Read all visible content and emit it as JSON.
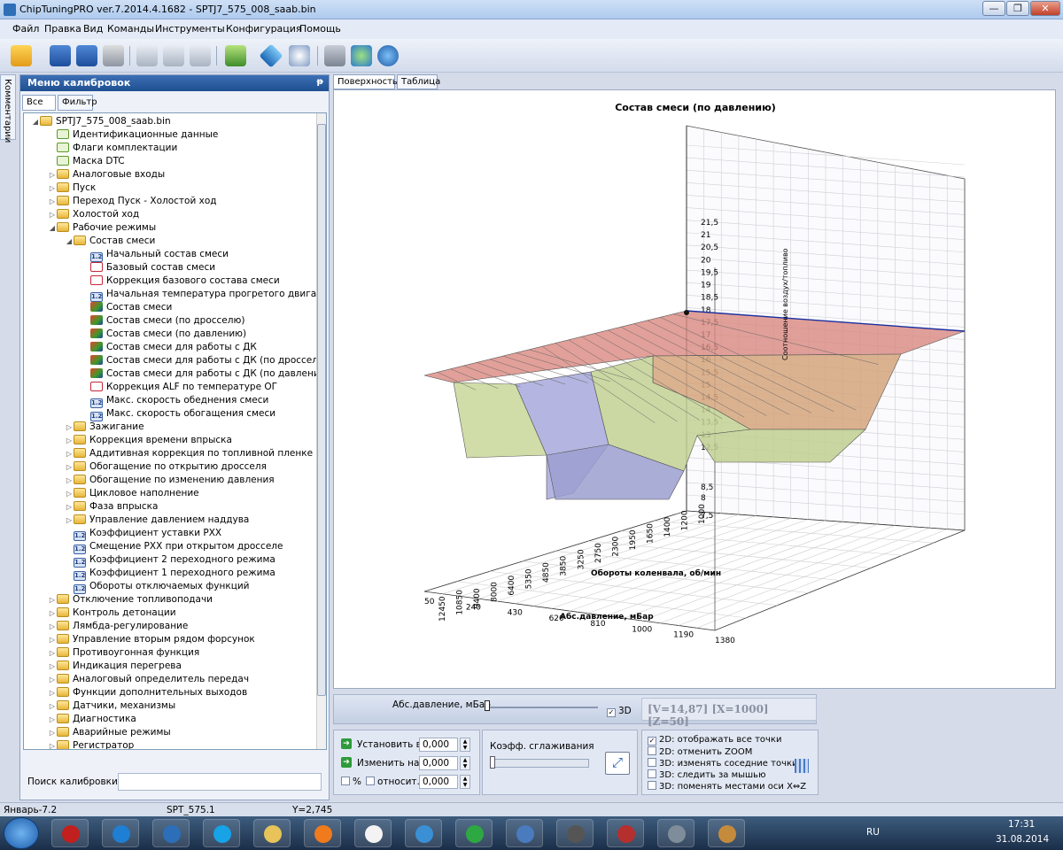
{
  "window": {
    "title": "ChipTuningPRO ver.7.2014.4.1682 - SPTJ7_575_008_saab.bin",
    "min": "—",
    "max": "❐",
    "close": "✕"
  },
  "menu": [
    "Файл",
    "Правка",
    "Вид",
    "Команды",
    "Инструменты",
    "Конфигурация",
    "Помощь"
  ],
  "toolbar_icons": [
    "open-icon",
    "save-icon",
    "save-as-icon",
    "print-icon",
    "copy-icon",
    "paste-icon",
    "undo-icon",
    "calculator-icon",
    "diamond-icon",
    "zoom-icon",
    "tools-icon",
    "network-icon",
    "help-icon"
  ],
  "side_tab": "Комментарии",
  "panel": {
    "title": "Меню калибровок",
    "pin": "ᵽ",
    "tabs": [
      "Все",
      "Фильтр"
    ],
    "search_label": "Поиск калибровки"
  },
  "tree": [
    {
      "label": "SPTJ7_575_008_saab.bin",
      "level": 0,
      "icon": "folder",
      "tw": "◢"
    },
    {
      "label": "Идентификационные данные",
      "level": 1,
      "icon": "check",
      "tw": ""
    },
    {
      "label": "Флаги комплектации",
      "level": 1,
      "icon": "check",
      "tw": ""
    },
    {
      "label": "Маска DTC",
      "level": 1,
      "icon": "check",
      "tw": ""
    },
    {
      "label": "Аналоговые входы",
      "level": 1,
      "icon": "folder",
      "tw": "▷"
    },
    {
      "label": "Пуск",
      "level": 1,
      "icon": "folder",
      "tw": "▷"
    },
    {
      "label": "Переход Пуск - Холостой ход",
      "level": 1,
      "icon": "folder",
      "tw": "▷"
    },
    {
      "label": "Холостой ход",
      "level": 1,
      "icon": "folder",
      "tw": "▷"
    },
    {
      "label": "Рабочие режимы",
      "level": 1,
      "icon": "folder",
      "tw": "◢"
    },
    {
      "label": "Состав смеси",
      "level": 2,
      "icon": "folder",
      "tw": "◢"
    },
    {
      "label": "Начальный состав смеси",
      "level": 3,
      "icon": "num",
      "tw": ""
    },
    {
      "label": "Базовый состав смеси",
      "level": 3,
      "icon": "map2d",
      "tw": ""
    },
    {
      "label": "Коррекция базового состава смеси",
      "level": 3,
      "icon": "map2d",
      "tw": ""
    },
    {
      "label": "Начальная температура прогретого двигателя",
      "level": 3,
      "icon": "num",
      "tw": ""
    },
    {
      "label": "Состав смеси",
      "level": 3,
      "icon": "map3d",
      "tw": ""
    },
    {
      "label": "Состав смеси (по дросселю)",
      "level": 3,
      "icon": "map3d",
      "tw": ""
    },
    {
      "label": "Состав смеси (по давлению)",
      "level": 3,
      "icon": "map3d",
      "tw": ""
    },
    {
      "label": "Состав смеси для работы с ДК",
      "level": 3,
      "icon": "map3d",
      "tw": ""
    },
    {
      "label": "Состав смеси для работы с ДК (по дросселю)",
      "level": 3,
      "icon": "map3d",
      "tw": ""
    },
    {
      "label": "Состав смеси для работы с ДК (по давлению)",
      "level": 3,
      "icon": "map3d",
      "tw": ""
    },
    {
      "label": "Коррекция ALF по температуре ОГ",
      "level": 3,
      "icon": "map2d",
      "tw": ""
    },
    {
      "label": "Макс. скорость обеднения смеси",
      "level": 3,
      "icon": "num",
      "tw": ""
    },
    {
      "label": "Макс. скорость обогащения смеси",
      "level": 3,
      "icon": "num",
      "tw": ""
    },
    {
      "label": "Зажигание",
      "level": 2,
      "icon": "folder",
      "tw": "▷"
    },
    {
      "label": "Коррекция времени впрыска",
      "level": 2,
      "icon": "folder",
      "tw": "▷"
    },
    {
      "label": "Аддитивная коррекция по топливной пленке",
      "level": 2,
      "icon": "folder",
      "tw": "▷"
    },
    {
      "label": "Обогащение по открытию дросселя",
      "level": 2,
      "icon": "folder",
      "tw": "▷"
    },
    {
      "label": "Обогащение по изменению давления",
      "level": 2,
      "icon": "folder",
      "tw": "▷"
    },
    {
      "label": "Цикловое наполнение",
      "level": 2,
      "icon": "folder",
      "tw": "▷"
    },
    {
      "label": "Фаза впрыска",
      "level": 2,
      "icon": "folder",
      "tw": "▷"
    },
    {
      "label": "Управление давлением наддува",
      "level": 2,
      "icon": "folder",
      "tw": "▷"
    },
    {
      "label": "Коэффициент уставки РХХ",
      "level": 2,
      "icon": "num",
      "tw": ""
    },
    {
      "label": "Смещение РХХ при открытом дросселе",
      "level": 2,
      "icon": "num",
      "tw": ""
    },
    {
      "label": "Коэффициент 2 переходного режима",
      "level": 2,
      "icon": "num",
      "tw": ""
    },
    {
      "label": "Коэффициент 1 переходного режима",
      "level": 2,
      "icon": "num",
      "tw": ""
    },
    {
      "label": "Обороты отключаемых функций",
      "level": 2,
      "icon": "num",
      "tw": ""
    },
    {
      "label": "Отключение топливоподачи",
      "level": 1,
      "icon": "folder",
      "tw": "▷"
    },
    {
      "label": "Контроль детонации",
      "level": 1,
      "icon": "folder",
      "tw": "▷"
    },
    {
      "label": "Лямбда-регулирование",
      "level": 1,
      "icon": "folder",
      "tw": "▷"
    },
    {
      "label": "Управление вторым рядом форсунок",
      "level": 1,
      "icon": "folder",
      "tw": "▷"
    },
    {
      "label": "Противоугонная функция",
      "level": 1,
      "icon": "folder",
      "tw": "▷"
    },
    {
      "label": "Индикация перегрева",
      "level": 1,
      "icon": "folder",
      "tw": "▷"
    },
    {
      "label": "Аналоговый определитель передач",
      "level": 1,
      "icon": "folder",
      "tw": "▷"
    },
    {
      "label": "Функции дополнительных выходов",
      "level": 1,
      "icon": "folder",
      "tw": "▷"
    },
    {
      "label": "Датчики, механизмы",
      "level": 1,
      "icon": "folder",
      "tw": "▷"
    },
    {
      "label": "Диагностика",
      "level": 1,
      "icon": "folder",
      "tw": "▷"
    },
    {
      "label": "Аварийные режимы",
      "level": 1,
      "icon": "folder",
      "tw": "▷"
    },
    {
      "label": "Регистратор",
      "level": 1,
      "icon": "folder",
      "tw": "▷"
    }
  ],
  "view_tabs": [
    "Поверхность",
    "Таблица"
  ],
  "chart_data": {
    "type": "surface",
    "title": "Состав смеси (по давлению)",
    "xlabel": "Абс.давление, мБар",
    "ylabel": "Обороты коленвала, об/мин",
    "zlabel": "Соотношение воздух/топливо",
    "x_ticks": [
      "50",
      "240",
      "430",
      "620",
      "810",
      "1000",
      "1190",
      "1380"
    ],
    "y_ticks": [
      "12450",
      "10850",
      "9400",
      "8000",
      "6400",
      "5350",
      "4850",
      "3850",
      "3250",
      "2750",
      "2300",
      "1950",
      "1650",
      "1400",
      "1200",
      "1000"
    ],
    "z_ticks": [
      "7,5",
      "8",
      "8,5",
      "12,5",
      "13",
      "13,5",
      "14",
      "14,5",
      "15",
      "15,5",
      "16",
      "16,5",
      "17",
      "17,5",
      "18",
      "18,5",
      "19",
      "19,5",
      "20",
      "20,5",
      "21",
      "21,5"
    ],
    "z_range": [
      7.5,
      21.5
    ],
    "cursor": {
      "V": 14.87,
      "X": 1000,
      "Z": 50
    }
  },
  "controls": {
    "axis_label": "Абс.давление, мБар",
    "cb3d": "3D",
    "coords": "[V=14,87] [X=1000] [Z=50]",
    "set": "Установить в",
    "change": "Изменить на",
    "percent": "%",
    "relative": "относит.",
    "val1": "0,000",
    "val2": "0,000",
    "val3": "0,000",
    "smooth": "Коэфф. сглаживания"
  },
  "options": [
    "2D: отображать все точки",
    "2D: отменить ZOOM",
    "3D: изменять соседние точки",
    "3D: следить за мышью",
    "3D: поменять местами оси X⇔Z"
  ],
  "status": {
    "left": "Январь-7.2",
    "mid": "SPT_575.1",
    "right": "Y=2,745"
  },
  "taskbar": {
    "lang": "RU",
    "time": "17:31",
    "date": "31.08.2014"
  },
  "taskbar_icons": [
    "start-button",
    "opera-icon",
    "ie-icon",
    "browser-icon",
    "skype-icon",
    "explorer-icon",
    "media-icon",
    "calendar-icon",
    "monitor-icon",
    "mail-icon",
    "airplane-icon",
    "tank-icon",
    "archiver-icon",
    "flash-icon",
    "paint-icon"
  ],
  "colors": {
    "accent": "#1f4f91",
    "surface_red": "#d98880",
    "surface_green": "#b9cf8a",
    "surface_blue": "#a7a8da"
  }
}
